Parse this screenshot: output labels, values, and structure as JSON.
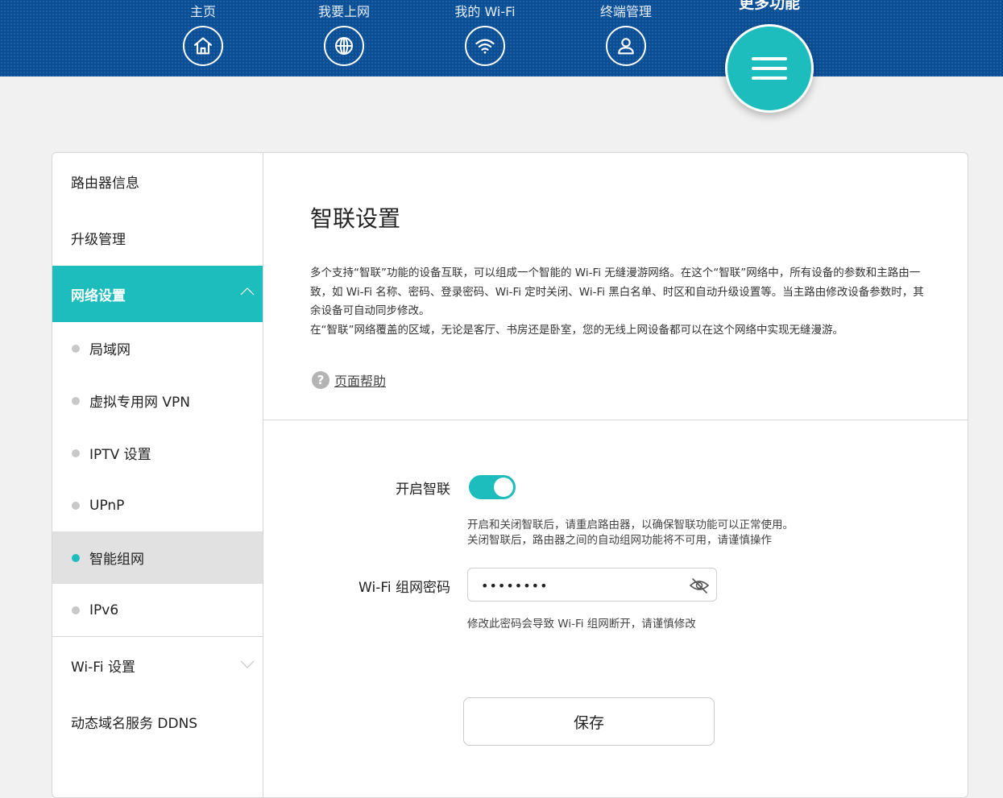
{
  "nav": {
    "items": [
      {
        "label": "主页",
        "icon": "home-icon"
      },
      {
        "label": "我要上网",
        "icon": "globe-icon"
      },
      {
        "label": "我的 Wi-Fi",
        "icon": "wifi-icon"
      },
      {
        "label": "终端管理",
        "icon": "user-icon"
      }
    ],
    "more": {
      "label": "更多功能",
      "icon": "menu-icon"
    }
  },
  "sidebar": {
    "items": [
      {
        "label": "路由器信息"
      },
      {
        "label": "升级管理"
      },
      {
        "label": "网络设置",
        "expanded": true
      }
    ],
    "sub_items": [
      {
        "label": "局域网"
      },
      {
        "label": "虚拟专用网 VPN"
      },
      {
        "label": "IPTV 设置"
      },
      {
        "label": "UPnP"
      },
      {
        "label": "智能组网",
        "selected": true
      },
      {
        "label": "IPv6"
      }
    ],
    "items_after": [
      {
        "label": "Wi-Fi 设置",
        "expanded": false
      },
      {
        "label": "动态域名服务 DDNS"
      }
    ]
  },
  "content": {
    "title": "智联设置",
    "description_1": "多个支持“智联”功能的设备互联，可以组成一个智能的 Wi-Fi 无缝漫游网络。在这个“智联”网络中，所有设备的参数和主路由一致，如 Wi-Fi 名称、密码、登录密码、Wi-Fi 定时关闭、Wi-Fi 黑白名单、时区和自动升级设置等。当主路由修改设备参数时，其余设备可自动同步修改。",
    "description_2": "在“智联”网络覆盖的区域，无论是客厅、书房还是卧室，您的无线上网设备都可以在这个网络中实现无缝漫游。",
    "help_label": "页面帮助",
    "toggle": {
      "label": "开启智联",
      "on": true,
      "hint_1": "开启和关闭智联后，请重启路由器，以确保智联功能可以正常使用。",
      "hint_2": "关闭智联后，路由器之间的自动组网功能将不可用，请谨慎操作"
    },
    "password": {
      "label": "Wi-Fi 组网密码",
      "value": "••••••••",
      "hint": "修改此密码会导致 Wi-Fi 组网断开，请谨慎修改"
    },
    "save_label": "保存"
  },
  "colors": {
    "accent": "#1dbdbd",
    "header": "#0a4f96"
  }
}
